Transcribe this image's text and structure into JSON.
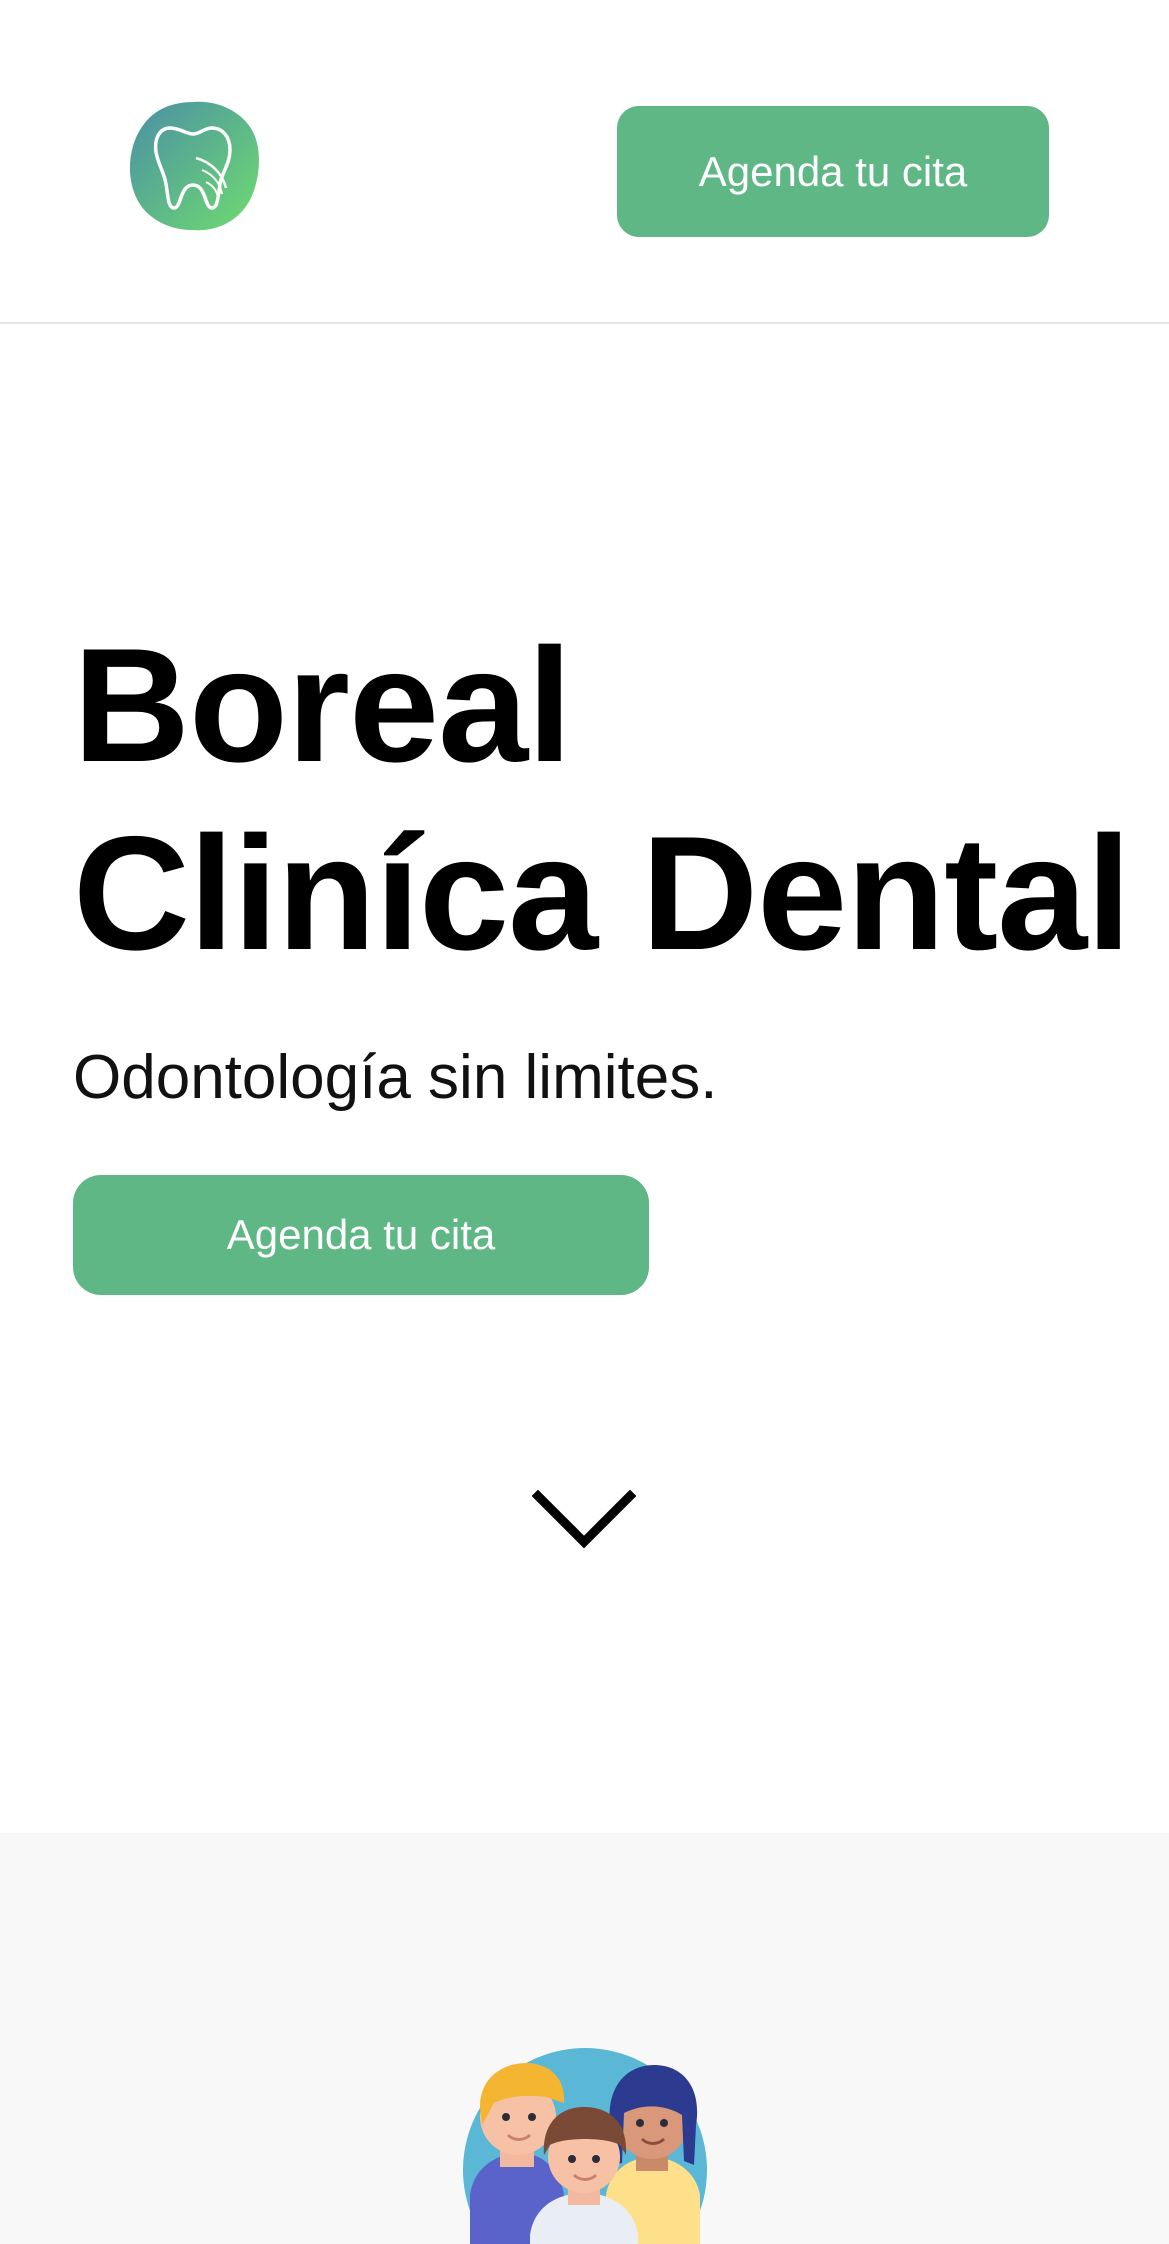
{
  "header": {
    "logo_icon": "tooth-logo-icon",
    "cta_label": "Agenda tu cita"
  },
  "hero": {
    "title_line1": "Boreal",
    "title_line2": "Cliníca Dental",
    "subtitle": "Odontología sin limites.",
    "cta_label": "Agenda tu cita",
    "scroll_icon": "chevron-down-icon"
  },
  "section": {
    "illustration_icon": "team-people-icon"
  },
  "colors": {
    "accent": "#5eb784",
    "logo_gradient_start": "#4f9aa8",
    "logo_gradient_end": "#6fd37a",
    "section_background": "#f8f8f8"
  }
}
